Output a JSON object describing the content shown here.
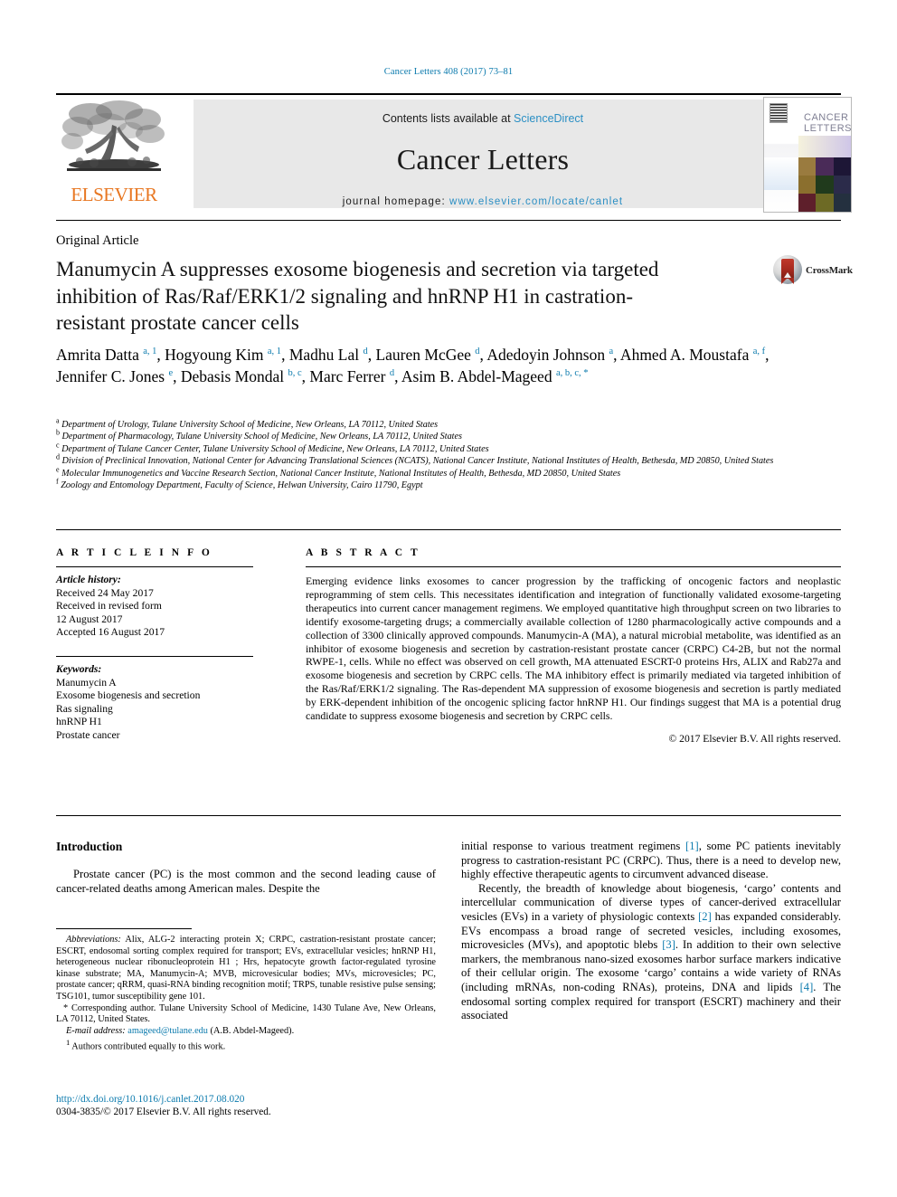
{
  "running_head": "Cancer Letters 408 (2017) 73–81",
  "masthead": {
    "publisher_name": "ELSEVIER",
    "contents_prefix": "Contents lists available at ",
    "contents_link": "ScienceDirect",
    "journal_title": "Cancer Letters",
    "homepage_label": "journal homepage: ",
    "homepage_url": "www.elsevier.com/locate/canlet",
    "cover_title_line1": "CANCER",
    "cover_title_line2": "LETTERS"
  },
  "article_type": "Original Article",
  "title": "Manumycin A suppresses exosome biogenesis and secretion via targeted inhibition of Ras/Raf/ERK1/2 signaling and hnRNP H1 in castration-resistant prostate cancer cells",
  "crossmark_label": "CrossMark",
  "authors_html": "Amrita Datta <sup>a, 1</sup>, Hogyoung Kim <sup>a, 1</sup>, Madhu Lal <sup>d</sup>, Lauren McGee <sup>d</sup>, Adedoyin Johnson <sup>a</sup>, Ahmed A. Moustafa <sup>a, f</sup>, Jennifer C. Jones <sup>e</sup>, Debasis Mondal <sup>b, c</sup>, Marc Ferrer <sup>d</sup>, Asim B. Abdel-Mageed <sup>a, b, c, *</sup>",
  "affiliations": [
    {
      "mark": "a",
      "text": "Department of Urology, Tulane University School of Medicine, New Orleans, LA 70112, United States"
    },
    {
      "mark": "b",
      "text": "Department of Pharmacology, Tulane University School of Medicine, New Orleans, LA 70112, United States"
    },
    {
      "mark": "c",
      "text": "Department of Tulane Cancer Center, Tulane University School of Medicine, New Orleans, LA 70112, United States"
    },
    {
      "mark": "d",
      "text": "Division of Preclinical Innovation, National Center for Advancing Translational Sciences (NCATS), National Cancer Institute, National Institutes of Health, Bethesda, MD 20850, United States"
    },
    {
      "mark": "e",
      "text": "Molecular Immunogenetics and Vaccine Research Section, National Cancer Institute, National Institutes of Health, Bethesda, MD 20850, United States"
    },
    {
      "mark": "f",
      "text": "Zoology and Entomology Department, Faculty of Science, Helwan University, Cairo 11790, Egypt"
    }
  ],
  "article_info": {
    "heading": "A R T I C L E  I N F O",
    "history_label": "Article history:",
    "history_lines": [
      "Received 24 May 2017",
      "Received in revised form",
      "12 August 2017",
      "Accepted 16 August 2017"
    ],
    "keywords_label": "Keywords:",
    "keywords": [
      "Manumycin A",
      "Exosome biogenesis and secretion",
      "Ras signaling",
      "hnRNP H1",
      "Prostate cancer"
    ]
  },
  "abstract": {
    "heading": "A B S T R A C T",
    "text": "Emerging evidence links exosomes to cancer progression by the trafficking of oncogenic factors and neoplastic reprogramming of stem cells. This necessitates identification and integration of functionally validated exosome-targeting therapeutics into current cancer management regimens. We employed quantitative high throughput screen on two libraries to identify exosome-targeting drugs; a commercially available collection of 1280 pharmacologically active compounds and a collection of 3300 clinically approved compounds. Manumycin-A (MA), a natural microbial metabolite, was identified as an inhibitor of exosome biogenesis and secretion by castration-resistant prostate cancer (CRPC) C4-2B, but not the normal RWPE-1, cells. While no effect was observed on cell growth, MA attenuated ESCRT-0 proteins Hrs, ALIX and Rab27a and exosome biogenesis and secretion by CRPC cells. The MA inhibitory effect is primarily mediated via targeted inhibition of the Ras/Raf/ERK1/2 signaling. The Ras-dependent MA suppression of exosome biogenesis and secretion is partly mediated by ERK-dependent inhibition of the oncogenic splicing factor hnRNP H1. Our findings suggest that MA is a potential drug candidate to suppress exosome biogenesis and secretion by CRPC cells.",
    "copyright": "© 2017 Elsevier B.V. All rights reserved."
  },
  "body": {
    "intro_heading": "Introduction",
    "left_paragraph_1": "Prostate cancer (PC) is the most common and the second leading cause of cancer-related deaths among American males. Despite the",
    "right_paragraph_1_part1": "initial response to various treatment regimens ",
    "right_paragraph_1_ref1": "[1]",
    "right_paragraph_1_part2": ", some PC patients inevitably progress to castration-resistant PC (CRPC). Thus, there is a need to develop new, highly effective therapeutic agents to circumvent advanced disease.",
    "right_paragraph_2_part1": "Recently, the breadth of knowledge about biogenesis, ‘cargo’ contents and intercellular communication of diverse types of cancer-derived extracellular vesicles (EVs) in a variety of physiologic contexts ",
    "right_paragraph_2_ref2": "[2]",
    "right_paragraph_2_part2": " has expanded considerably. EVs encompass a broad range of secreted vesicles, including exosomes, microvesicles (MVs), and apoptotic blebs ",
    "right_paragraph_2_ref3": "[3]",
    "right_paragraph_2_part3": ". In addition to their own selective markers, the membranous nano-sized exosomes harbor surface markers indicative of their cellular origin. The exosome ‘cargo’ contains a wide variety of RNAs (including mRNAs, non-coding RNAs), proteins, DNA and lipids ",
    "right_paragraph_2_ref4": "[4]",
    "right_paragraph_2_part4": ". The endosomal sorting complex required for transport (ESCRT) machinery and their associated"
  },
  "footnotes": {
    "abbrev_label": "Abbreviations:",
    "abbrev_text": " Alix, ALG-2 interacting protein X; CRPC, castration-resistant prostate cancer; ESCRT, endosomal sorting complex required for transport; EVs, extracellular vesicles; hnRNP H1, heterogeneous nuclear ribonucleoprotein H1 ; Hrs, hepatocyte growth factor-regulated tyrosine kinase substrate; MA, Manumycin-A; MVB, microvesicular bodies; MVs, microvesicles; PC, prostate cancer; qRRM, quasi-RNA binding recognition motif; TRPS, tunable resistive pulse sensing; TSG101, tumor susceptibility gene 101.",
    "corresponding_marker": "*",
    "corresponding_text": " Corresponding author. Tulane University School of Medicine, 1430 Tulane Ave, New Orleans, LA 70112, United States.",
    "email_label": "E-mail address:",
    "email_link": "amageed@tulane.edu",
    "email_suffix": " (A.B. Abdel-Mageed).",
    "equal_marker": "1",
    "equal_text": " Authors contributed equally to this work."
  },
  "footer": {
    "doi": "http://dx.doi.org/10.1016/j.canlet.2017.08.020",
    "issn_line": "0304-3835/© 2017 Elsevier B.V. All rights reserved."
  },
  "colors": {
    "link": "#0b7aad",
    "sciencedirect": "#2b8fc4",
    "elsevier_orange": "#e87722"
  }
}
